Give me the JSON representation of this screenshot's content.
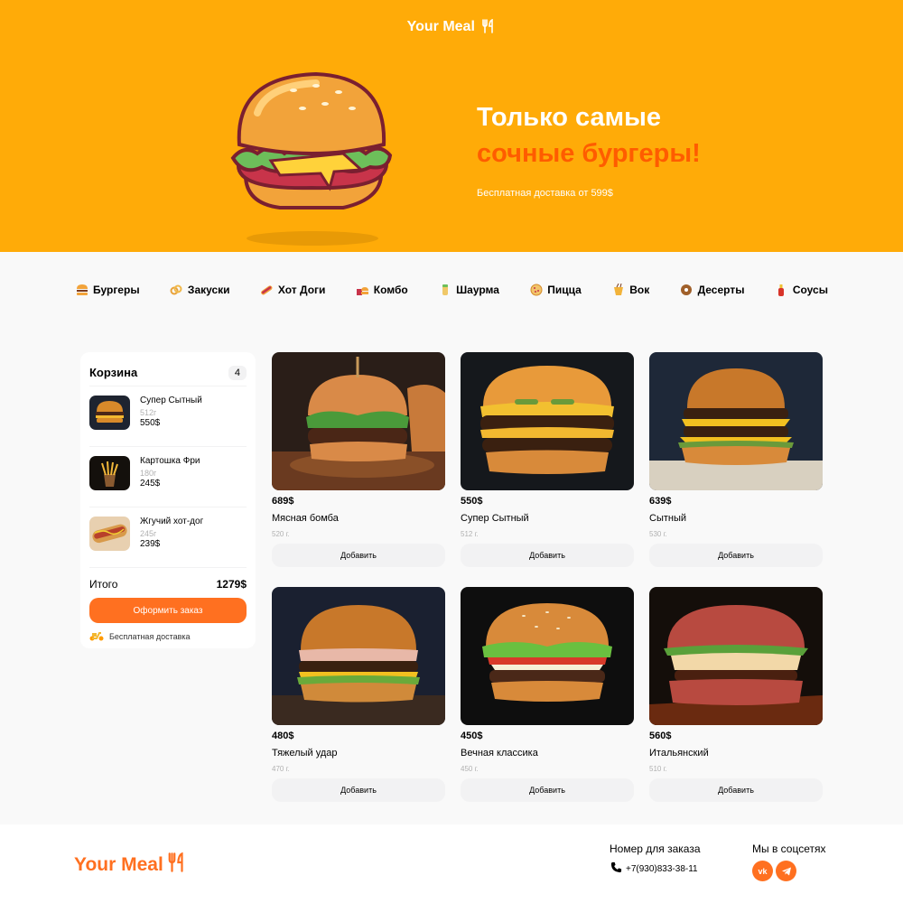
{
  "header": {
    "logo": "Your Meal"
  },
  "hero": {
    "title_line1": "Только самые",
    "title_line2": "сочные бургеры!",
    "subtitle": "Бесплатная доставка от 599$"
  },
  "categories": [
    {
      "label": "Бургеры",
      "icon": "burger-icon"
    },
    {
      "label": "Закуски",
      "icon": "onion-rings-icon"
    },
    {
      "label": "Хот Доги",
      "icon": "hotdog-icon"
    },
    {
      "label": "Комбо",
      "icon": "combo-icon"
    },
    {
      "label": "Шаурма",
      "icon": "shawarma-icon"
    },
    {
      "label": "Пицца",
      "icon": "pizza-icon"
    },
    {
      "label": "Вок",
      "icon": "wok-icon"
    },
    {
      "label": "Десерты",
      "icon": "donut-icon"
    },
    {
      "label": "Соусы",
      "icon": "sauce-icon"
    }
  ],
  "cart": {
    "title": "Корзина",
    "count": "4",
    "items": [
      {
        "name": "Супер Сытный",
        "weight": "512г",
        "price": "550$"
      },
      {
        "name": "Картошка Фри",
        "weight": "180г",
        "price": "245$"
      },
      {
        "name": "Жгучий хот-дог",
        "weight": "245г",
        "price": "239$"
      }
    ],
    "total_label": "Итого",
    "total_value": "1279$",
    "order_button": "Оформить заказ",
    "delivery": "Бесплатная доставка"
  },
  "products": [
    {
      "price": "689$",
      "name": "Мясная бомба",
      "weight": "520 г.",
      "button": "Добавить"
    },
    {
      "price": "550$",
      "name": "Супер Сытный",
      "weight": "512 г.",
      "button": "Добавить"
    },
    {
      "price": "639$",
      "name": "Сытный",
      "weight": "530 г.",
      "button": "Добавить"
    },
    {
      "price": "480$",
      "name": "Тяжелый удар",
      "weight": "470 г.",
      "button": "Добавить"
    },
    {
      "price": "450$",
      "name": "Вечная классика",
      "weight": "450 г.",
      "button": "Добавить"
    },
    {
      "price": "560$",
      "name": "Итальянский",
      "weight": "510 г.",
      "button": "Добавить"
    }
  ],
  "footer": {
    "logo": "Your Meal",
    "phone_title": "Номер для заказа",
    "phone": "+7(930)833-38-11",
    "social_title": "Мы в соцсетях",
    "social": [
      {
        "label": "vk",
        "icon": "vk-icon"
      },
      {
        "label": "telegram",
        "icon": "telegram-icon"
      }
    ]
  },
  "colors": {
    "primary": "#ffab08",
    "accent": "#ff7020",
    "hero_accent": "#ff5c00",
    "bg": "#f9f9f9",
    "button_gray": "#f2f2f3"
  }
}
